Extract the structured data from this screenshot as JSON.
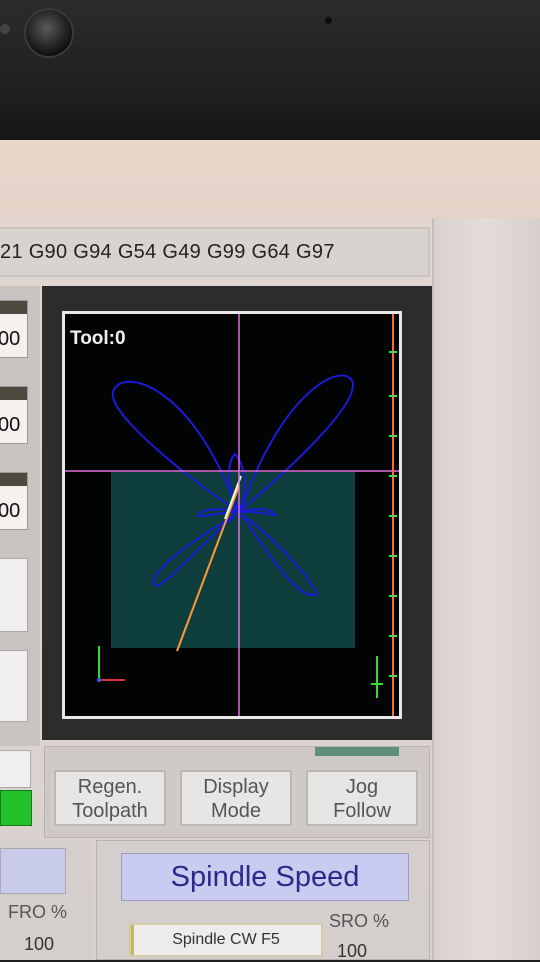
{
  "gcode_modes": "21 G90 G94 G54 G49 G99 G64 G97",
  "dro_values": [
    "00",
    "00",
    "00"
  ],
  "toolpath": {
    "tool_label": "Tool:0"
  },
  "buttons": {
    "regen": [
      "Regen.",
      "Toolpath"
    ],
    "display_mode": [
      "Display",
      "Mode"
    ],
    "jog_follow": [
      "Jog",
      "Follow"
    ]
  },
  "feed": {
    "fro_label": "FRO %",
    "fro_value": "100"
  },
  "spindle": {
    "title": "Spindle Speed",
    "cw_button": "Spindle CW F5",
    "sro_label": "SRO %",
    "sro_value": "100"
  },
  "colors": {
    "toolpath": "#1a1ad8",
    "crosshair": "#e070e0",
    "cut_line": "#ff9a40",
    "work_area": "#0f3f3c",
    "spindle_title_bg": "#c9cbf0",
    "spindle_title_text": "#2a2a8a",
    "status_green": "#24c02a"
  }
}
